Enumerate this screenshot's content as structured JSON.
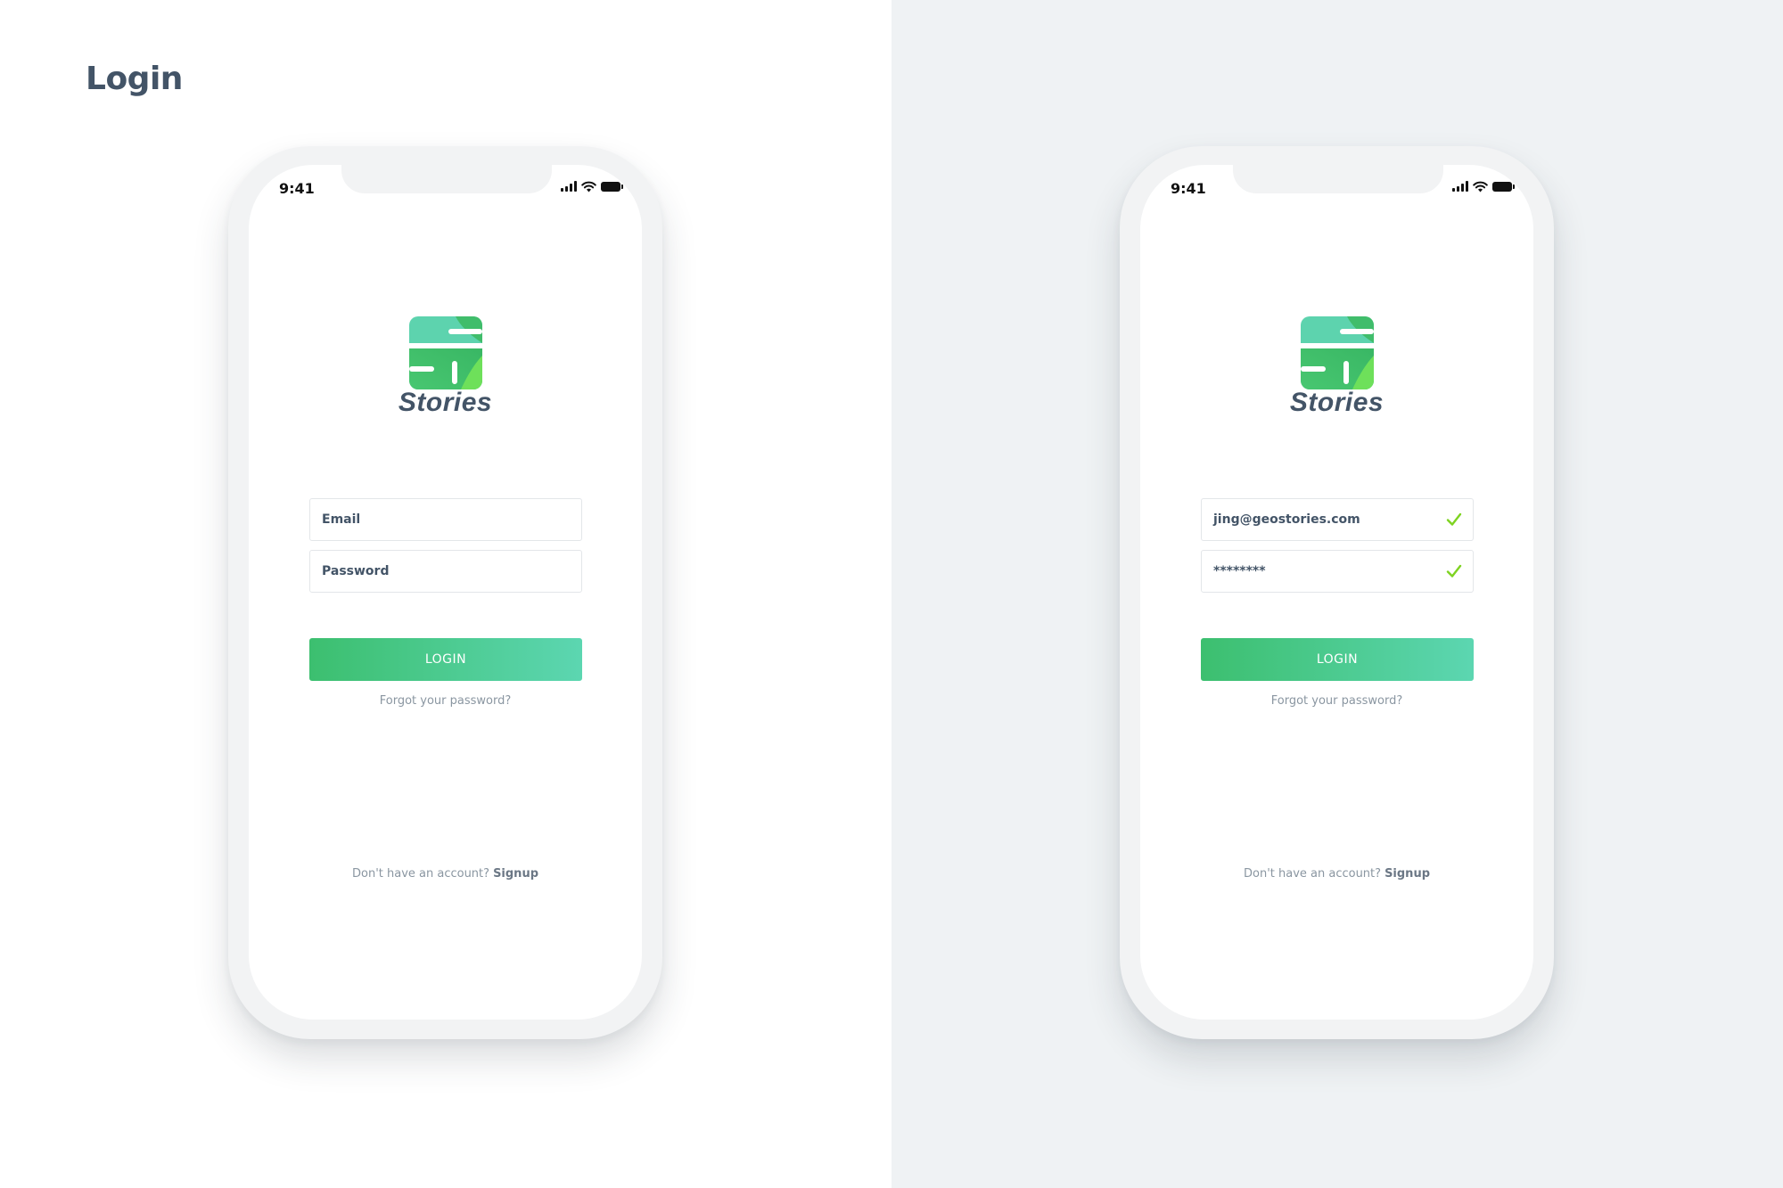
{
  "page": {
    "title": "Login"
  },
  "colors": {
    "brand_green": "#3cbf6f",
    "brand_teal": "#5cd6b1",
    "text_dark": "#435467",
    "text_muted": "#8a96a1",
    "check_green": "#7ed321"
  },
  "phones": [
    {
      "status": {
        "time": "9:41",
        "icons": [
          "signal-icon",
          "wifi-icon",
          "battery-icon"
        ]
      },
      "logo": {
        "text": "Stories"
      },
      "email": {
        "text": "Email",
        "state": "placeholder"
      },
      "password": {
        "text": "Password",
        "state": "placeholder"
      },
      "login_label": "LOGIN",
      "forgot_label": "Forgot your password?",
      "signup_prompt": "Don't have an account?",
      "signup_label": "Signup"
    },
    {
      "status": {
        "time": "9:41",
        "icons": [
          "signal-icon",
          "wifi-icon",
          "battery-icon"
        ]
      },
      "logo": {
        "text": "Stories"
      },
      "email": {
        "text": "jing@geostories.com",
        "state": "valid",
        "icon": "check-icon"
      },
      "password": {
        "text": "********",
        "state": "valid",
        "icon": "check-icon"
      },
      "login_label": "LOGIN",
      "forgot_label": "Forgot your password?",
      "signup_prompt": "Don't have an account?",
      "signup_label": "Signup"
    }
  ]
}
